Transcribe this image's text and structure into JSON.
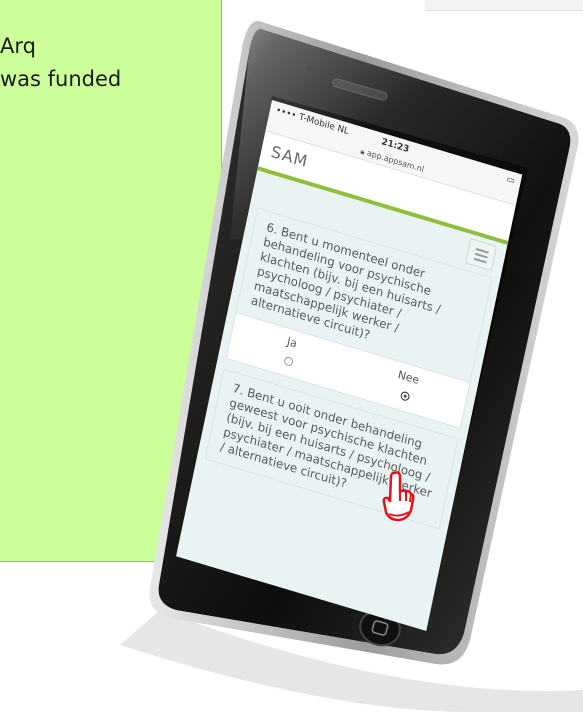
{
  "slide": {
    "text_lines": [
      "Arq",
      "was funded"
    ],
    "accent_colors": {
      "green_box": "#ccff99",
      "app_green": "#8dbf3b",
      "hand_red": "#e0141c"
    }
  },
  "phone": {
    "status_bar": {
      "carrier": "•••• T-Mobile NL",
      "time": "21:23"
    },
    "url": "app.appsam.nl",
    "app_title": "SAM",
    "menu_icon": "hamburger-icon",
    "questions": [
      {
        "text": "6. Bent u momenteel onder behandeling voor psychische klachten (bijv. bij een huisarts / psycholoog / psychiater / maatschappelijk werker / alternatieve circuit)?",
        "options": [
          {
            "label": "Ja",
            "selected": false
          },
          {
            "label": "Nee",
            "selected": true
          }
        ]
      },
      {
        "text": "7. Bent u ooit onder behandeling geweest voor psychische klachten (bijv. bij een huisarts / psycholoog / psychiater / maatschappelijk werker / alternatieve circuit)?"
      }
    ],
    "pointer_icon": "pointing-hand-icon"
  }
}
